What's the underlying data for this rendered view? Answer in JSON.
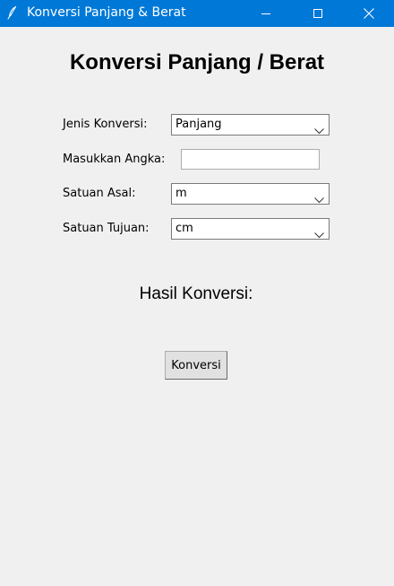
{
  "window": {
    "title": "Konversi Panjang & Berat",
    "icon": "feather-icon",
    "titlebar_color": "#0078d7",
    "buttons": [
      "minimize-icon",
      "maximize-icon",
      "close-icon"
    ]
  },
  "heading": "Konversi Panjang / Berat",
  "form": {
    "jenis_label": "Jenis Konversi:",
    "jenis_value": "Panjang",
    "angka_label": "Masukkan Angka:",
    "angka_value": "",
    "asal_label": "Satuan Asal:",
    "asal_value": "m",
    "tujuan_label": "Satuan Tujuan:",
    "tujuan_value": "cm"
  },
  "result_label": "Hasil Konversi:",
  "convert_button": "Konversi",
  "colors": {
    "background": "#f0f0f0",
    "button_face": "#e1e1e1"
  }
}
